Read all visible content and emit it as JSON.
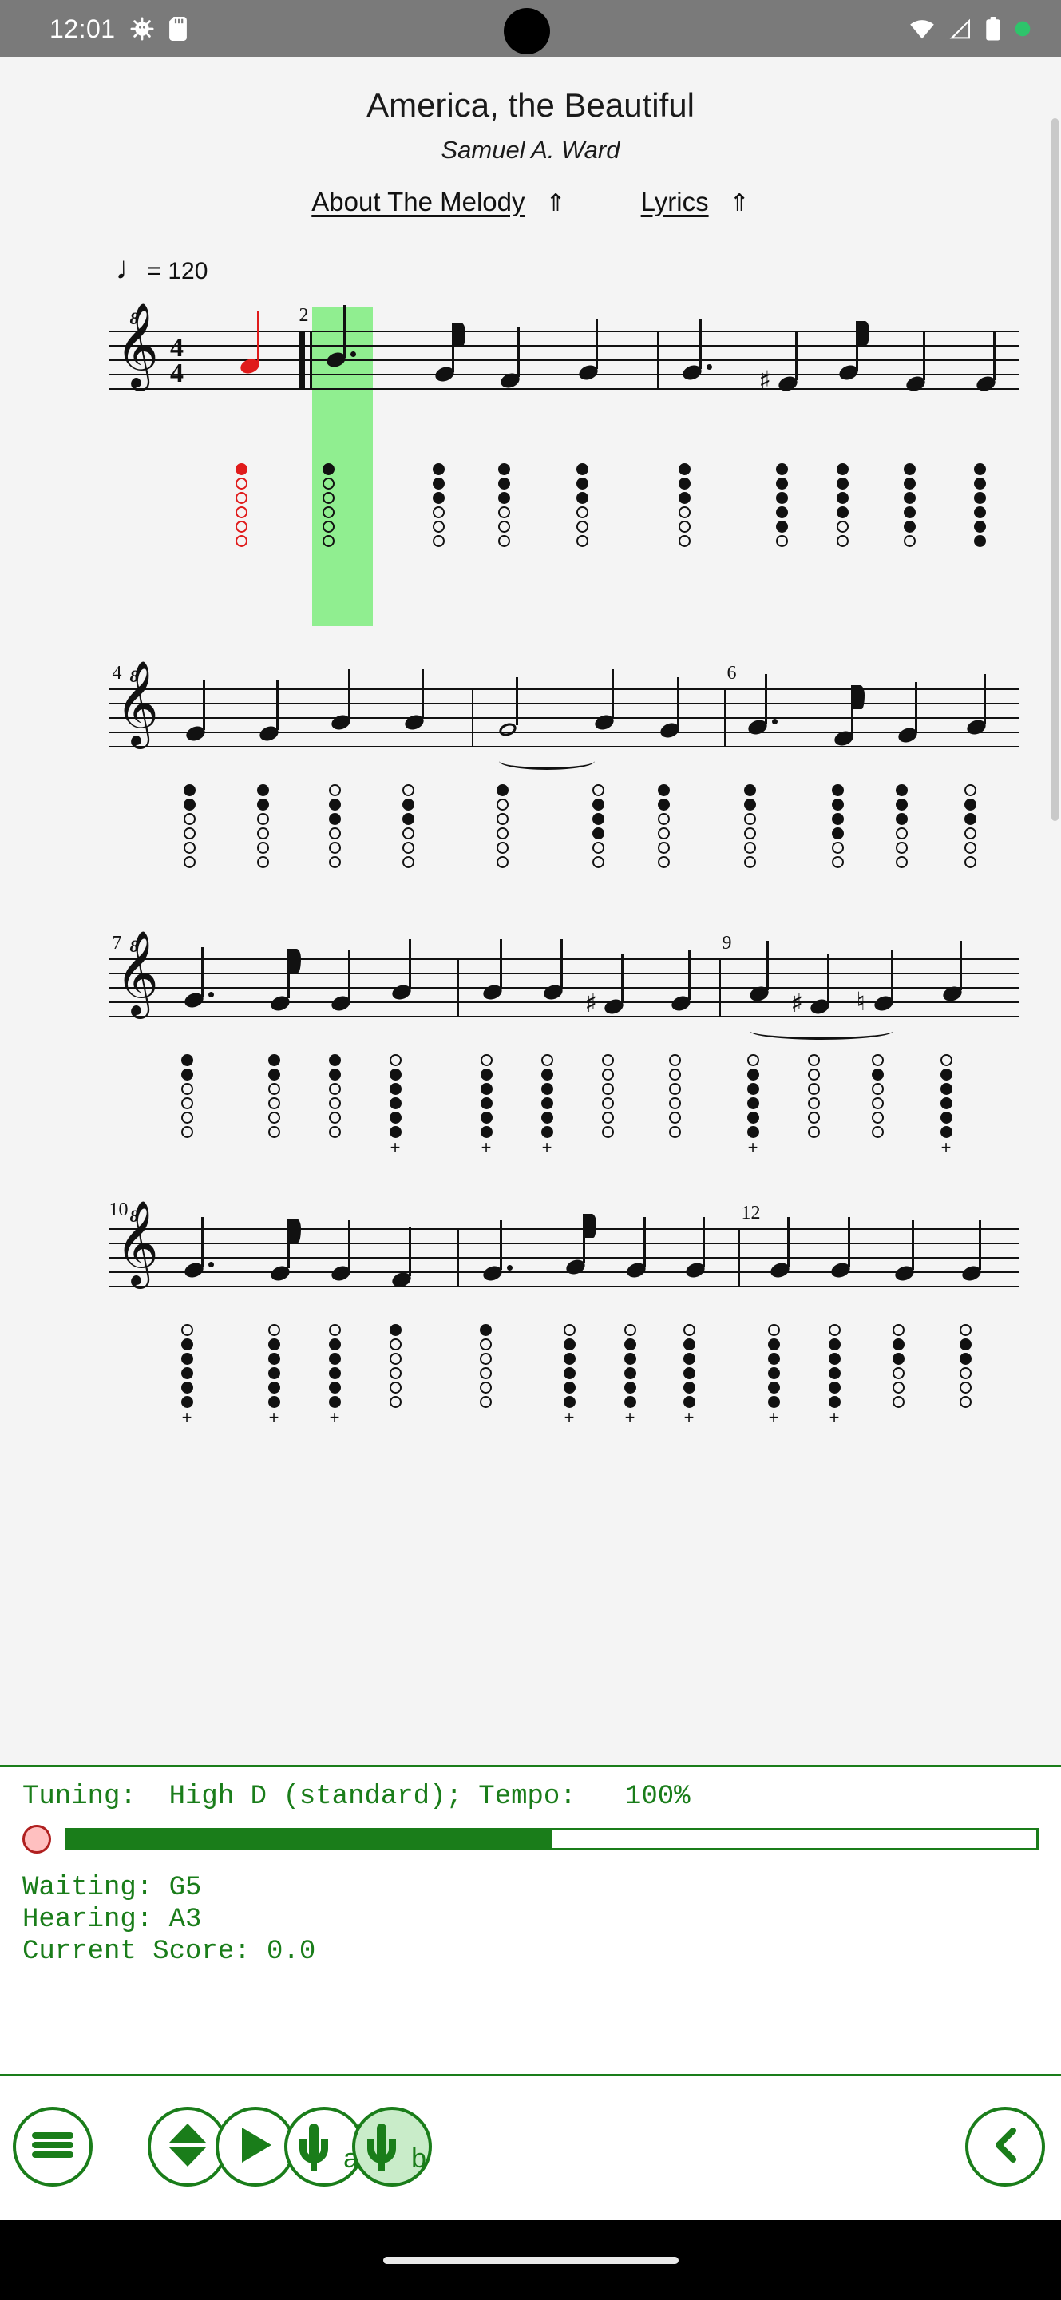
{
  "status_bar": {
    "time": "12:01",
    "left_icons": [
      "bug-icon",
      "sd-card-icon"
    ],
    "right_icons": [
      "wifi-icon",
      "cell-signal-icon",
      "battery-icon",
      "recording-dot-icon"
    ]
  },
  "song": {
    "title": "America, the Beautiful",
    "composer": "Samuel A. Ward"
  },
  "links": [
    {
      "label": "About The Melody",
      "arrow": "⇑"
    },
    {
      "label": "Lyrics",
      "arrow": "⇑"
    }
  ],
  "score": {
    "tempo_text": "= 120",
    "tempo_note_glyph": "♩",
    "time_signature": {
      "numerator": "4",
      "denominator": "4"
    },
    "clef": "treble-8va-bassa",
    "clef_octave_label": "8",
    "measure_numbers": [
      "2",
      "4",
      "6",
      "7",
      "9",
      "10",
      "12"
    ],
    "highlighted_measure": "2",
    "highlight_color": "#90ee90",
    "cursor_note_color": "#e01b1b",
    "overblow_marker": "+",
    "systems": [
      {
        "start_measure_label": "",
        "measures": [
          "2",
          "3"
        ]
      },
      {
        "start_measure_label": "4",
        "measures": [
          "4",
          "5",
          "6"
        ]
      },
      {
        "start_measure_label": "7",
        "measures": [
          "7",
          "8",
          "9"
        ]
      },
      {
        "start_measure_label": "10",
        "measures": [
          "10",
          "11",
          "12"
        ]
      }
    ]
  },
  "status_panel": {
    "tuning_line": "Tuning:  High D (standard); Tempo:   100%",
    "tuning_label": "Tuning:",
    "tuning_value": "High D (standard)",
    "tempo_label": "Tempo:",
    "tempo_value": "100%",
    "led_state": "idle",
    "progress_percent": 50,
    "waiting_line": "Waiting: G5",
    "hearing_line": "Hearing: A3",
    "score_line": "Current Score: 0.0",
    "waiting_note": "G5",
    "hearing_note": "A3",
    "current_score": "0.0",
    "text_color": "#1a7d1a"
  },
  "toolbar": {
    "buttons": [
      {
        "name": "menu-button",
        "icon": "hamburger-icon",
        "label": "",
        "active": false
      },
      {
        "name": "transpose-button",
        "icon": "up-down-arrows-icon",
        "label": "",
        "active": false
      },
      {
        "name": "play-button",
        "icon": "play-icon",
        "label": "",
        "active": false
      },
      {
        "name": "mic-a-button",
        "icon": "microphone-icon",
        "label": "a",
        "active": false
      },
      {
        "name": "mic-b-button",
        "icon": "microphone-icon",
        "label": "b",
        "active": true
      },
      {
        "name": "back-button",
        "icon": "chevron-left-icon",
        "label": "",
        "active": false
      }
    ]
  },
  "theme": {
    "accent_green": "#1a7d1a",
    "highlight_green": "#90ee90",
    "active_fill": "#c9ecc9",
    "red": "#e01b1b",
    "page_bg": "#f4f4f4",
    "status_bar_bg": "#7a7a7a"
  }
}
